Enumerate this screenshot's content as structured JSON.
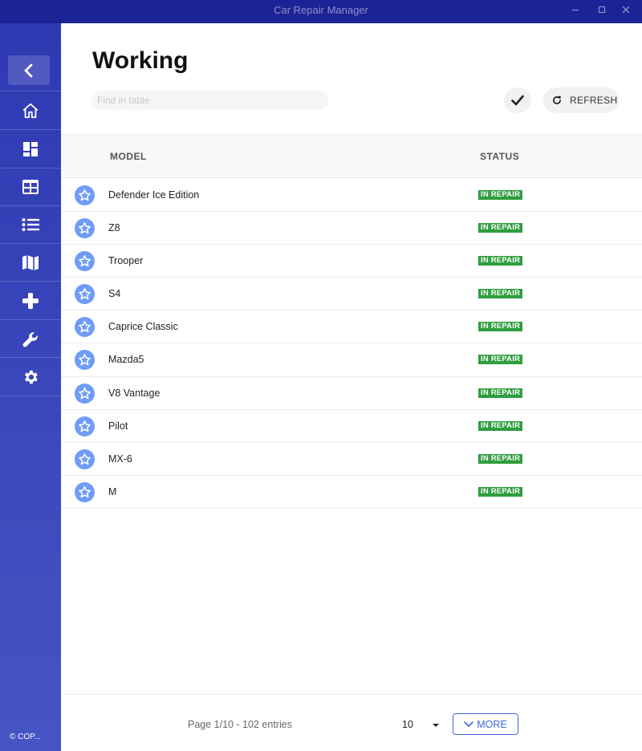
{
  "window": {
    "title": "Car Repair Manager"
  },
  "sidebar": {
    "items": [
      {
        "icon": "chevron-left-icon",
        "name": "back"
      },
      {
        "icon": "home-icon",
        "name": "home"
      },
      {
        "icon": "dashboard-icon",
        "name": "dashboard"
      },
      {
        "icon": "table-icon",
        "name": "table"
      },
      {
        "icon": "list-icon",
        "name": "list"
      },
      {
        "icon": "map-icon",
        "name": "map"
      },
      {
        "icon": "plus-icon",
        "name": "add"
      },
      {
        "icon": "wrench-icon",
        "name": "repair"
      },
      {
        "icon": "gear-icon",
        "name": "settings"
      }
    ],
    "copyright": "© COP..."
  },
  "main": {
    "title": "Working",
    "search": {
      "placeholder": "Find in table",
      "value": ""
    },
    "refresh_label": "REFRESH"
  },
  "table": {
    "columns": [
      "MODEL",
      "STATUS"
    ],
    "rows": [
      {
        "model": "Defender Ice Edition",
        "status": "IN REPAIR"
      },
      {
        "model": "Z8",
        "status": "IN REPAIR"
      },
      {
        "model": "Trooper",
        "status": "IN REPAIR"
      },
      {
        "model": "S4",
        "status": "IN REPAIR"
      },
      {
        "model": "Caprice Classic",
        "status": "IN REPAIR"
      },
      {
        "model": "Mazda5",
        "status": "IN REPAIR"
      },
      {
        "model": "V8 Vantage",
        "status": "IN REPAIR"
      },
      {
        "model": "Pilot",
        "status": "IN REPAIR"
      },
      {
        "model": "MX-6",
        "status": "IN REPAIR"
      },
      {
        "model": "M",
        "status": "IN REPAIR"
      }
    ]
  },
  "footer": {
    "page_info": "Page 1/10 - 102 entries",
    "page_size": "10",
    "more_label": "MORE"
  },
  "colors": {
    "titlebar": "#1c2396",
    "sidebar": "#3a45bb",
    "accent": "#3f66e0",
    "status_badge": "#2f9e3f",
    "avatar": "#6f9cf6"
  }
}
